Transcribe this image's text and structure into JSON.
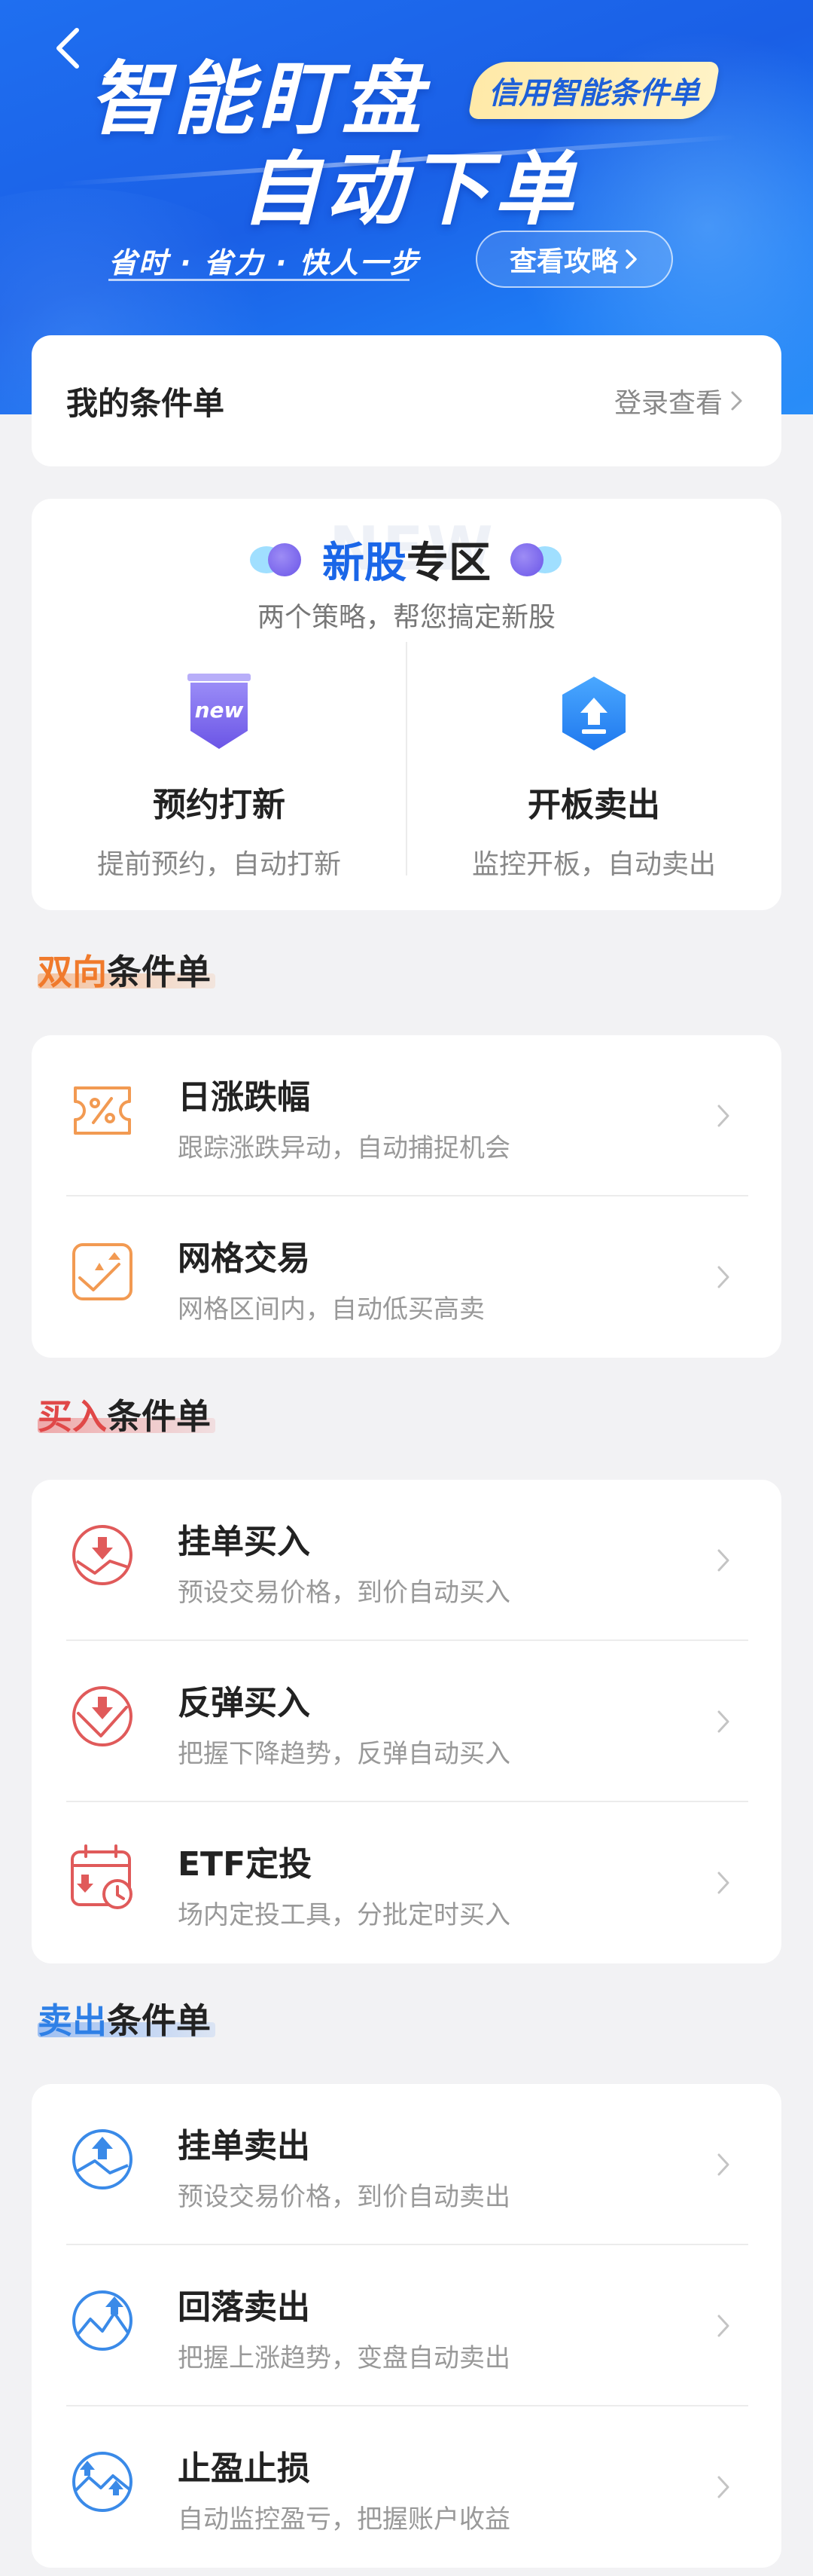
{
  "banner": {
    "title_line1": "智能盯盘",
    "title_line2": "自动下单",
    "tag": "信用智能条件单",
    "slogan": "省时 · 省力 · 快人一步",
    "guide_button": "查看攻略",
    "colors": {
      "primary": "#1a66e8",
      "tag_bg": "#ffecb0"
    }
  },
  "my_orders": {
    "label": "我的条件单",
    "action": "登录查看"
  },
  "ipo": {
    "watermark": "NEW",
    "title_blue": "新股",
    "title_rest": "专区",
    "subtitle": "两个策略，帮您搞定新股",
    "items": [
      {
        "name": "预约打新",
        "desc": "提前预约，自动打新",
        "icon": "new-badge-icon",
        "badge": "new"
      },
      {
        "name": "开板卖出",
        "desc": "监控开板，自动卖出",
        "icon": "upload-arrow-icon"
      }
    ]
  },
  "sections": [
    {
      "title_colored": "双向",
      "title_rest": "条件单",
      "color": "#f07a2c",
      "items": [
        {
          "name": "日涨跌幅",
          "desc": "跟踪涨跌异动，自动捕捉机会",
          "icon": "percent-ticket-icon"
        },
        {
          "name": "网格交易",
          "desc": "网格区间内，自动低买高卖",
          "icon": "grid-trade-icon"
        }
      ]
    },
    {
      "title_colored": "买入",
      "title_rest": "条件单",
      "color": "#e04848",
      "items": [
        {
          "name": "挂单买入",
          "desc": "预设交易价格，到价自动买入",
          "icon": "limit-buy-icon"
        },
        {
          "name": "反弹买入",
          "desc": "把握下降趋势，反弹自动买入",
          "icon": "rebound-buy-icon"
        },
        {
          "name": "ETF定投",
          "desc": "场内定投工具，分批定时买入",
          "icon": "etf-schedule-icon"
        }
      ]
    },
    {
      "title_colored": "卖出",
      "title_rest": "条件单",
      "color": "#2f80e6",
      "items": [
        {
          "name": "挂单卖出",
          "desc": "预设交易价格，到价自动卖出",
          "icon": "limit-sell-icon"
        },
        {
          "name": "回落卖出",
          "desc": "把握上涨趋势，变盘自动卖出",
          "icon": "pullback-sell-icon"
        },
        {
          "name": "止盈止损",
          "desc": "自动监控盈亏，把握账户收益",
          "icon": "stop-profit-loss-icon"
        }
      ]
    }
  ]
}
